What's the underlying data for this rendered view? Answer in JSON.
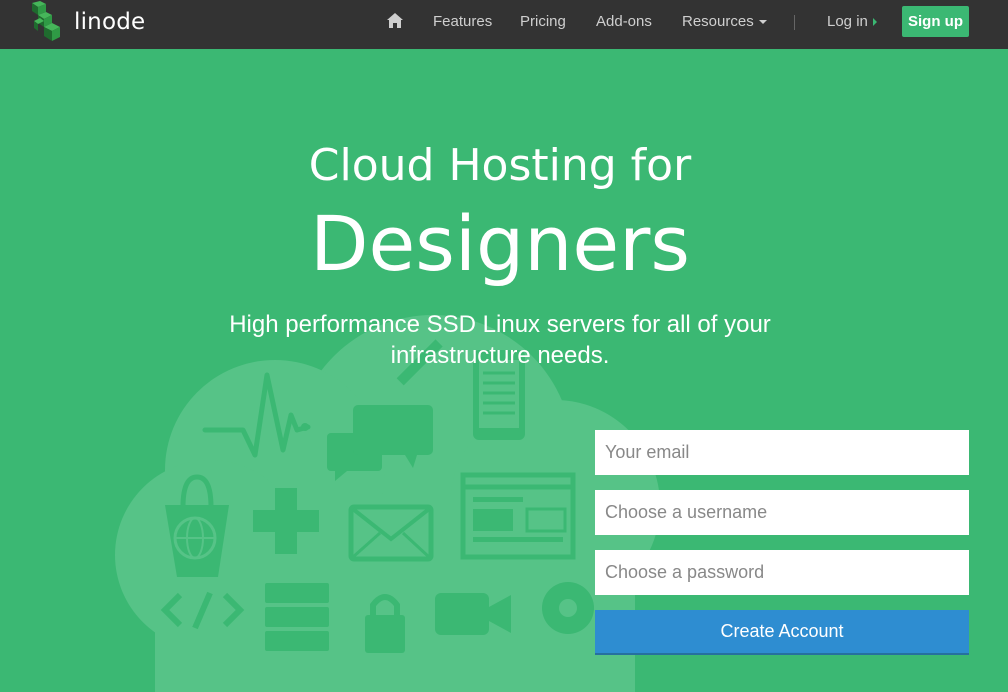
{
  "nav": {
    "logo_text": "linode",
    "links": {
      "features": "Features",
      "pricing": "Pricing",
      "addons": "Add-ons",
      "resources": "Resources"
    },
    "login": "Log in",
    "signup": "Sign up"
  },
  "hero": {
    "line1": "Cloud Hosting for",
    "line2": "Designers",
    "subtitle": "High performance SSD Linux servers for all of your infrastructure needs."
  },
  "form": {
    "email_placeholder": "Your email",
    "username_placeholder": "Choose a username",
    "password_placeholder": "Choose a password",
    "submit_label": "Create Account"
  },
  "colors": {
    "brand_green": "#3bb873",
    "nav_background": "#333333",
    "button_blue": "#2e8dd1"
  },
  "icons": [
    "home-icon",
    "cloud-illustration",
    "heartbeat-icon",
    "chat-icon",
    "mobile-icon",
    "shopping-bag-icon",
    "dpad-icon",
    "mail-icon",
    "browser-window-icon",
    "code-icon",
    "server-icon",
    "lock-icon",
    "video-camera-icon",
    "gear-icon"
  ]
}
